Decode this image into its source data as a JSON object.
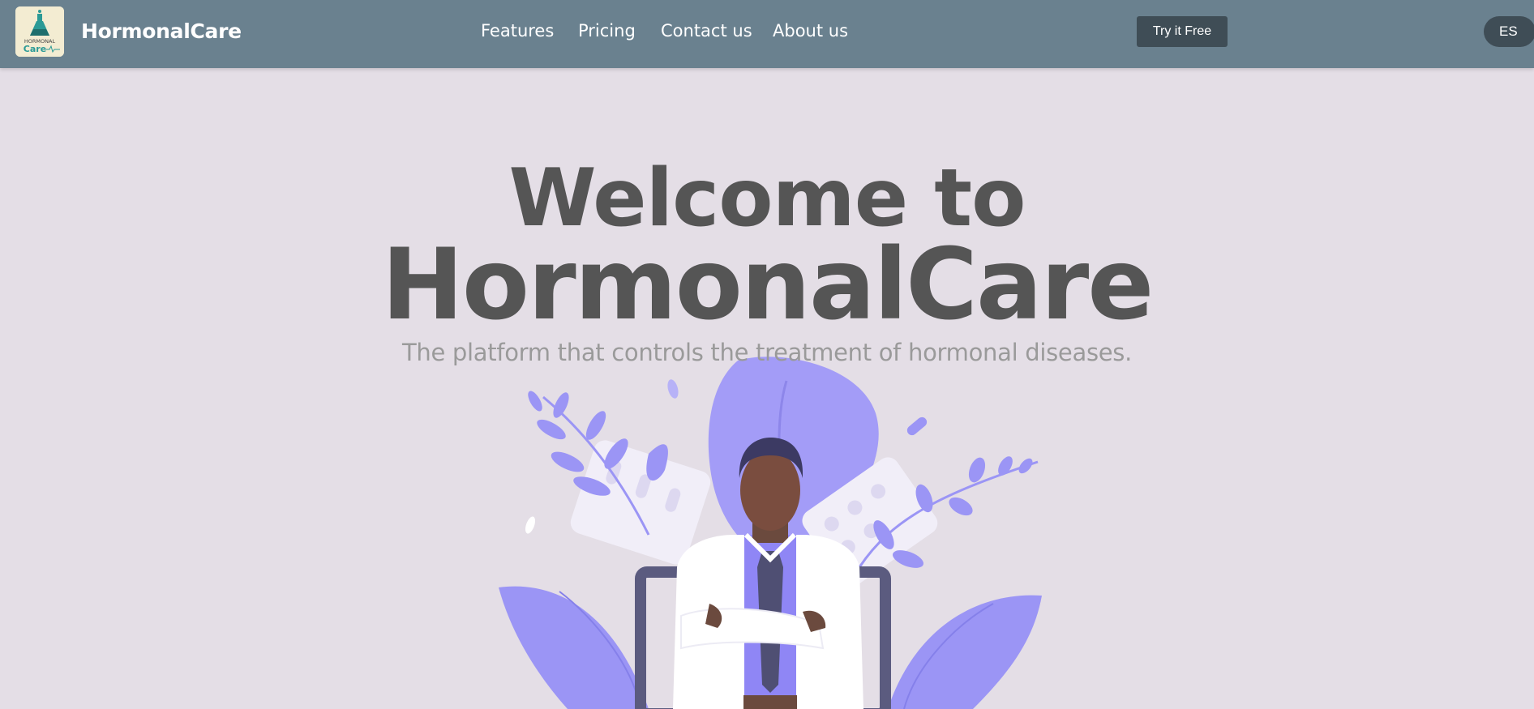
{
  "header": {
    "brand": "HormonalCare",
    "logo_text_top": "HORMONAL",
    "logo_text_bottom": "Care",
    "nav": [
      {
        "label": "Features"
      },
      {
        "label": "Pricing"
      },
      {
        "label": "Contact us"
      },
      {
        "label": "About us"
      }
    ],
    "cta_label": "Try it Free",
    "language_label": "ES"
  },
  "hero": {
    "title_line1": "Welcome to",
    "title_line2": "HormonalCare",
    "subtitle": "The platform that controls the treatment of hormonal diseases."
  },
  "colors": {
    "navbar": "#6a818f",
    "background": "#e4dee6",
    "button": "#3f4d56",
    "accent_purple": "#9b95f5",
    "text_dark": "#555555",
    "text_muted": "#9a9a9a"
  },
  "icons": {
    "logo": "flask-icon",
    "illustration": "doctor-illustration"
  }
}
